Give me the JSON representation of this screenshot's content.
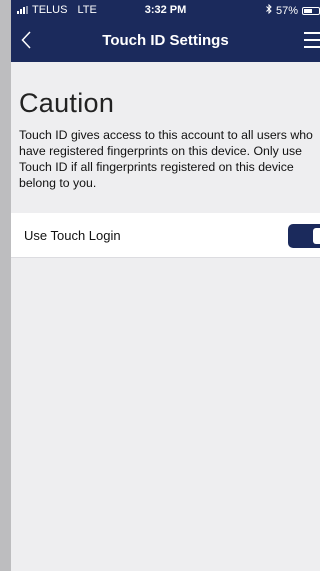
{
  "status_bar": {
    "carrier": "TELUS",
    "network": "LTE",
    "time": "3:32 PM",
    "battery": "57%",
    "battery_level": 0.57
  },
  "nav": {
    "title": "Touch ID Settings",
    "back_icon": "chevron-left-icon",
    "menu_icon": "hamburger-menu-icon"
  },
  "caution": {
    "title": "Caution",
    "text": "Touch ID gives access to this account to all users who have registered fingerprints on this device. Only use Touch ID if all fingerprints registered on this device belong to you."
  },
  "setting": {
    "label": "Use Touch Login",
    "enabled": true
  },
  "colors": {
    "brand": "#1b2a5c",
    "background": "#eeeef0"
  }
}
